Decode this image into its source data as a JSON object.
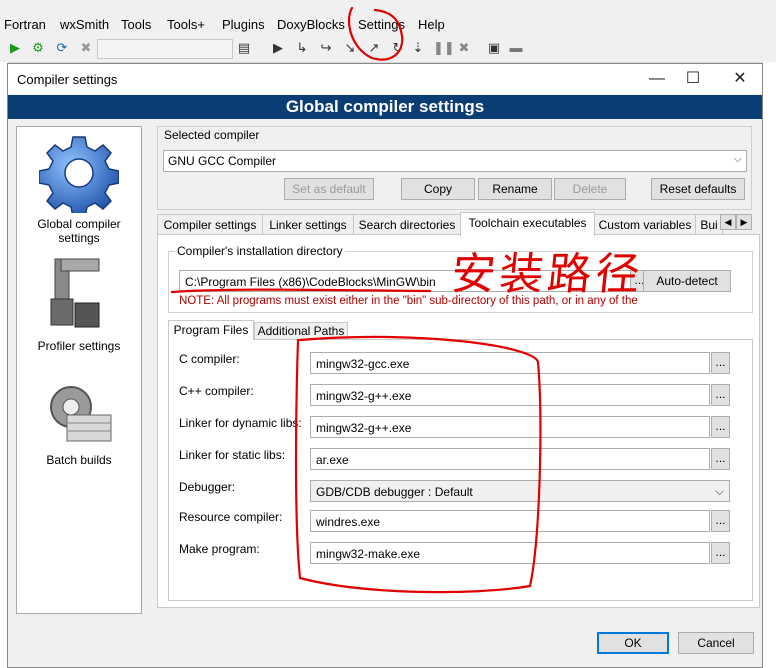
{
  "menubar": [
    "Fortran",
    "wxSmith",
    "Tools",
    "Tools+",
    "Plugins",
    "DoxyBlocks",
    "Settings",
    "Help"
  ],
  "dialog": {
    "title": "Compiler settings",
    "banner": "Global compiler settings",
    "left_panel": [
      {
        "label": "Global compiler settings",
        "icon": "gear-icon"
      },
      {
        "label": "Profiler settings",
        "icon": "profiler-icon"
      },
      {
        "label": "Batch builds",
        "icon": "batch-icon"
      }
    ],
    "selected_compiler": {
      "label": "Selected compiler",
      "value": "GNU GCC Compiler",
      "buttons": [
        "Set as default",
        "Copy",
        "Rename",
        "Delete",
        "Reset defaults"
      ]
    },
    "tabs": [
      "Compiler settings",
      "Linker settings",
      "Search directories",
      "Toolchain executables",
      "Custom variables",
      "Bui"
    ],
    "install_dir": {
      "label": "Compiler's installation directory",
      "value": "C:\\Program Files (x86)\\CodeBlocks\\MinGW\\bin",
      "auto_detect": "Auto-detect",
      "note": "NOTE: All programs must exist either in the \"bin\" sub-directory of this path, or in any of the"
    },
    "subtabs": [
      "Program Files",
      "Additional Paths"
    ],
    "programs": [
      {
        "label": "C compiler:",
        "value": "mingw32-gcc.exe"
      },
      {
        "label": "C++ compiler:",
        "value": "mingw32-g++.exe"
      },
      {
        "label": "Linker for dynamic libs:",
        "value": "mingw32-g++.exe"
      },
      {
        "label": "Linker for static libs:",
        "value": "ar.exe"
      },
      {
        "label": "Debugger:",
        "value": "GDB/CDB debugger : Default"
      },
      {
        "label": "Resource compiler:",
        "value": "windres.exe"
      },
      {
        "label": "Make program:",
        "value": "mingw32-make.exe"
      }
    ],
    "ok": "OK",
    "cancel": "Cancel"
  },
  "annotation_text": "安装路径"
}
